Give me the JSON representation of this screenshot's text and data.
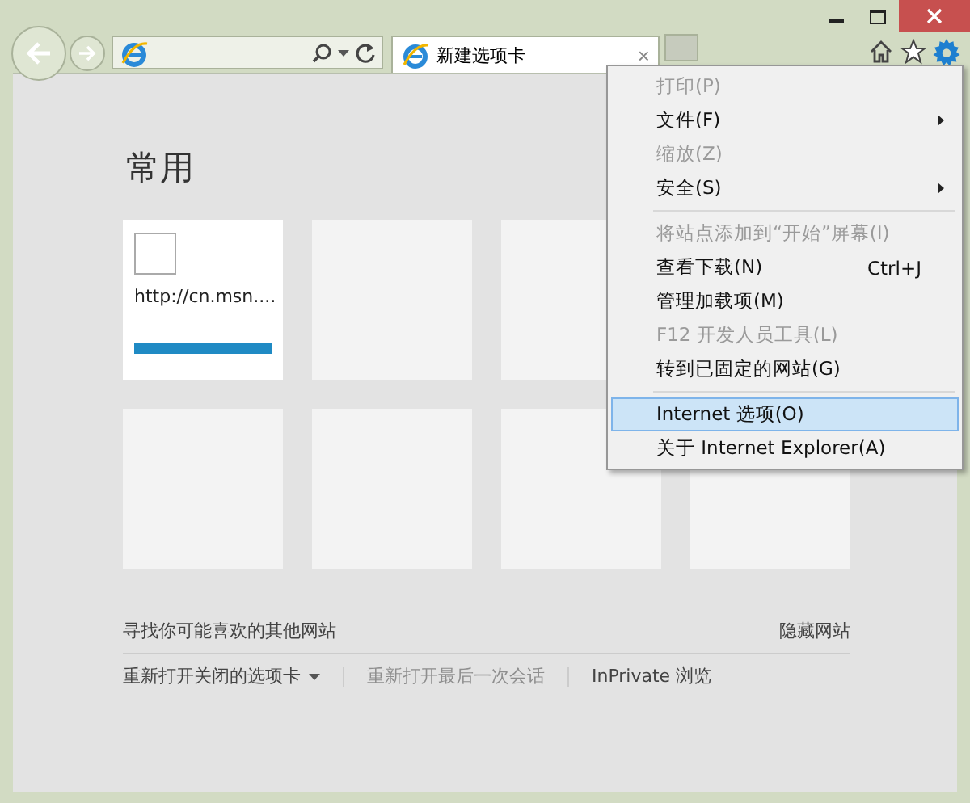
{
  "window": {
    "controls": [
      {
        "kind": "minimize"
      },
      {
        "kind": "maximize"
      },
      {
        "kind": "close"
      }
    ]
  },
  "tab": {
    "title": "新建选项卡",
    "close": "×"
  },
  "page": {
    "heading": "常用",
    "tile_rows": [
      [
        {
          "kind": "site",
          "url": "http://cn.msn...."
        },
        {
          "kind": "empty"
        },
        {
          "kind": "empty"
        }
      ],
      [
        {
          "kind": "empty"
        },
        {
          "kind": "empty"
        },
        {
          "kind": "empty"
        },
        {
          "kind": "empty"
        }
      ]
    ],
    "discover": "寻找你可能喜欢的其他网站",
    "hide": "隐藏网站",
    "links": [
      {
        "label": "重新打开关闭的选项卡",
        "disabled": false,
        "dropdown": true
      },
      {
        "label": "重新打开最后一次会话",
        "disabled": true,
        "dropdown": false
      },
      {
        "label": "InPrivate 浏览",
        "disabled": false,
        "dropdown": false
      }
    ]
  },
  "menu": {
    "groups": [
      [
        {
          "label": "打印(P)",
          "disabled": true,
          "submenu": false,
          "selected": false
        },
        {
          "label": "文件(F)",
          "disabled": false,
          "submenu": true,
          "selected": false
        },
        {
          "label": "缩放(Z)",
          "disabled": true,
          "submenu": false,
          "selected": false
        },
        {
          "label": "安全(S)",
          "disabled": false,
          "submenu": true,
          "selected": false
        }
      ],
      [
        {
          "label": "将站点添加到“开始”屏幕(I)",
          "disabled": true,
          "submenu": false,
          "selected": false
        },
        {
          "label": "查看下载(N)",
          "shortcut": "Ctrl+J",
          "disabled": false,
          "submenu": false,
          "selected": false
        },
        {
          "label": "管理加载项(M)",
          "disabled": false,
          "submenu": false,
          "selected": false
        },
        {
          "label": "F12 开发人员工具(L)",
          "disabled": true,
          "submenu": false,
          "selected": false
        },
        {
          "label": "转到已固定的网站(G)",
          "disabled": false,
          "submenu": false,
          "selected": false
        }
      ],
      [
        {
          "label": "Internet 选项(O)",
          "disabled": false,
          "submenu": false,
          "selected": true
        },
        {
          "label": "关于 Internet Explorer(A)",
          "disabled": false,
          "submenu": false,
          "selected": false
        }
      ]
    ]
  }
}
